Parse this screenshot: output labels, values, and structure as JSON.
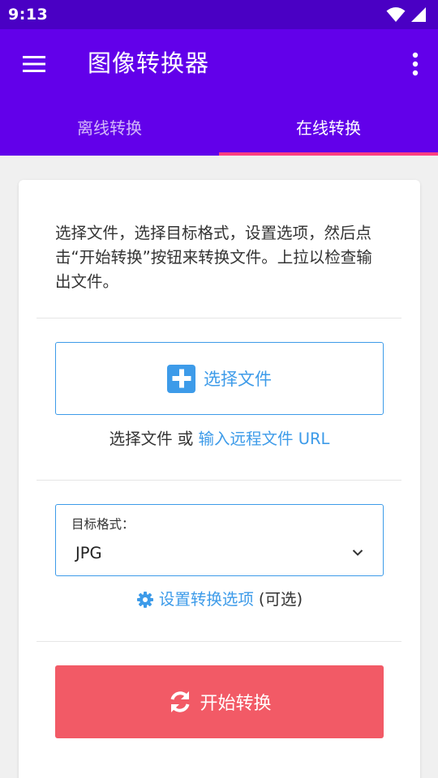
{
  "status_bar": {
    "time": "9:13"
  },
  "app_bar": {
    "title": "图像转换器"
  },
  "tabs": [
    {
      "label": "离线转换",
      "active": false
    },
    {
      "label": "在线转换",
      "active": true
    }
  ],
  "card": {
    "instructions": "选择文件，选择目标格式，设置选项，然后点击“开始转换”按钮来转换文件。上拉以检查输出文件。",
    "choose_file_button": "选择文件",
    "choose_file_text": "选择文件",
    "or_text": "或",
    "remote_url_link": "输入远程文件 URL",
    "target_format_label": "目标格式：",
    "target_format_value": "JPG",
    "options_link": "设置转换选项",
    "options_optional": "(可选)",
    "start_button": "开始转换"
  },
  "colors": {
    "status_bar": "#4a00c4",
    "primary": "#6200ea",
    "tab_indicator": "#ff4081",
    "accent_blue": "#3d9be9",
    "start_button": "#f25a66"
  },
  "icons": [
    "menu-icon",
    "more-vert-icon",
    "wifi-icon",
    "signal-icon",
    "plus-icon",
    "chevron-down-icon",
    "gear-icon",
    "sync-icon"
  ]
}
